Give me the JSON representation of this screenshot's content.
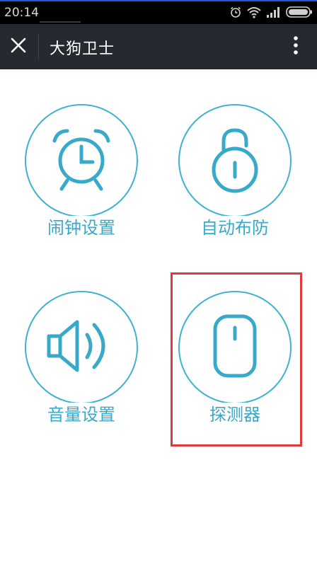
{
  "status_bar": {
    "time": "20:14",
    "icons": [
      "alarm-clock-icon",
      "wifi-icon",
      "signal-icon",
      "battery-icon"
    ]
  },
  "title_bar": {
    "close_icon": "close-icon",
    "title": "大狗卫士",
    "menu_icon": "more-vertical-icon"
  },
  "tiles": [
    {
      "label": "闹钟设置",
      "icon": "alarm-clock-icon"
    },
    {
      "label": "自动布防",
      "icon": "padlock-icon"
    },
    {
      "label": "音量设置",
      "icon": "speaker-icon"
    },
    {
      "label": "探测器",
      "icon": "detector-icon",
      "highlighted": true
    }
  ],
  "colors": {
    "accent": "#39a9c9",
    "title_bar": "#252a30",
    "status_bar": "#000000",
    "highlight": "#e0393e"
  }
}
